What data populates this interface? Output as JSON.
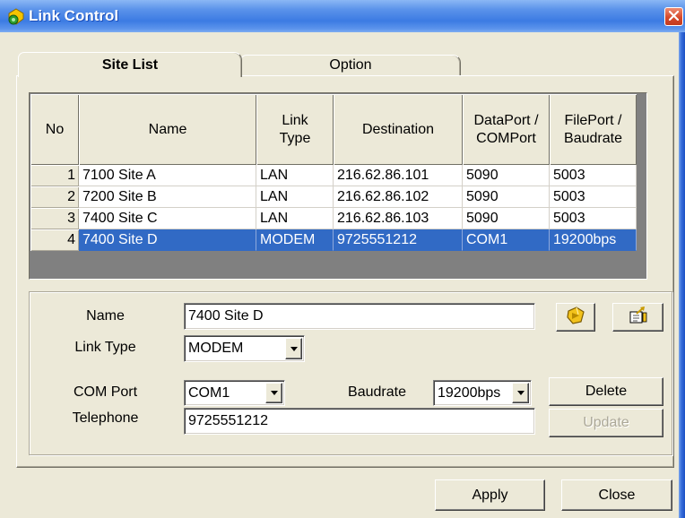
{
  "window": {
    "title": "Link Control"
  },
  "icons": {
    "app": "link-control-app-icon",
    "close": "close-icon",
    "connect": "connect-icon",
    "import": "import-icon",
    "dropdown": "chevron-down-icon"
  },
  "tabs": [
    {
      "label": "Site List",
      "active": true
    },
    {
      "label": "Option",
      "active": false
    }
  ],
  "grid": {
    "headers": {
      "no": "No",
      "name": "Name",
      "link_type": [
        "Link",
        "Type"
      ],
      "destination": "Destination",
      "dataport": [
        "DataPort /",
        "COMPort"
      ],
      "fileport": [
        "FilePort /",
        "Baudrate"
      ]
    },
    "rows": [
      {
        "no": "1",
        "name": "7100 Site A",
        "link_type": "LAN",
        "destination": "216.62.86.101",
        "dataport": "5090",
        "fileport": "5003",
        "selected": false
      },
      {
        "no": "2",
        "name": "7200 Site B",
        "link_type": "LAN",
        "destination": "216.62.86.102",
        "dataport": "5090",
        "fileport": "5003",
        "selected": false
      },
      {
        "no": "3",
        "name": "7400 Site C",
        "link_type": "LAN",
        "destination": "216.62.86.103",
        "dataport": "5090",
        "fileport": "5003",
        "selected": false
      },
      {
        "no": "4",
        "name": "7400 Site D",
        "link_type": "MODEM",
        "destination": "9725551212",
        "dataport": "COM1",
        "fileport": "19200bps",
        "selected": true
      }
    ]
  },
  "form": {
    "name_label": "Name",
    "name_value": "7400 Site D",
    "link_type_label": "Link Type",
    "link_type_value": "MODEM",
    "com_port_label": "COM Port",
    "com_port_value": "COM1",
    "baudrate_label": "Baudrate",
    "baudrate_value": "19200bps",
    "telephone_label": "Telephone",
    "telephone_value": "9725551212",
    "delete_label": "Delete",
    "update_label": "Update",
    "update_enabled": false
  },
  "footer": {
    "apply_label": "Apply",
    "close_label": "Close"
  },
  "colors": {
    "selection": "#316AC5",
    "title_bar": "#3C7BE3",
    "window_background": "#ECE9D8",
    "grid_background": "#808080",
    "disabled_text": "#ACA899",
    "close_button": "#D64A2C"
  }
}
